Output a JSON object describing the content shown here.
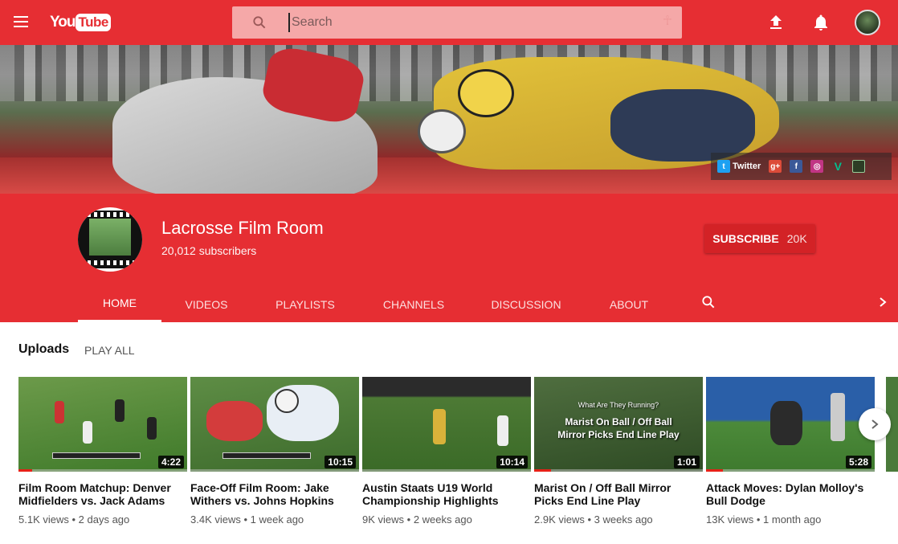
{
  "masthead": {
    "logo_you": "You",
    "logo_tube": "Tube",
    "search_placeholder": "Search"
  },
  "banner": {
    "twitter_label": "Twitter",
    "social_icons": [
      "twitter-icon",
      "google-plus-icon",
      "facebook-icon",
      "instagram-icon",
      "vine-icon",
      "film-icon"
    ]
  },
  "channel": {
    "title": "Lacrosse Film Room",
    "subscribers": "20,012 subscribers",
    "subscribe_label": "SUBSCRIBE",
    "subscribe_count": "20K"
  },
  "tabs": [
    "HOME",
    "VIDEOS",
    "PLAYLISTS",
    "CHANNELS",
    "DISCUSSION",
    "ABOUT"
  ],
  "active_tab": "HOME",
  "uploads": {
    "title": "Uploads",
    "play_all": "PLAY ALL",
    "videos": [
      {
        "title": "Film Room Matchup: Denver Midfielders vs. Jack Adams",
        "duration": "4:22",
        "views": "5.1K views",
        "age": "2 days ago",
        "watched": 0.08
      },
      {
        "title": "Face-Off Film Room: Jake Withers vs. Johns Hopkins",
        "duration": "10:15",
        "views": "3.4K views",
        "age": "1 week ago",
        "watched": 0
      },
      {
        "title": "Austin Staats U19 World Championship Highlights",
        "duration": "10:14",
        "views": "9K views",
        "age": "2 weeks ago",
        "watched": 0
      },
      {
        "title": "Marist On / Off Ball Mirror Picks End Line Play",
        "duration": "1:01",
        "views": "2.9K views",
        "age": "3 weeks ago",
        "watched": 0.1,
        "overlay_small": "What Are They Running?",
        "overlay_big": "Marist On Ball / Off Ball Mirror Picks End Line Play"
      },
      {
        "title": "Attack Moves: Dylan Molloy's Bull Dodge",
        "duration": "5:28",
        "views": "13K views",
        "age": "1 month ago",
        "watched": 0.1
      }
    ]
  }
}
